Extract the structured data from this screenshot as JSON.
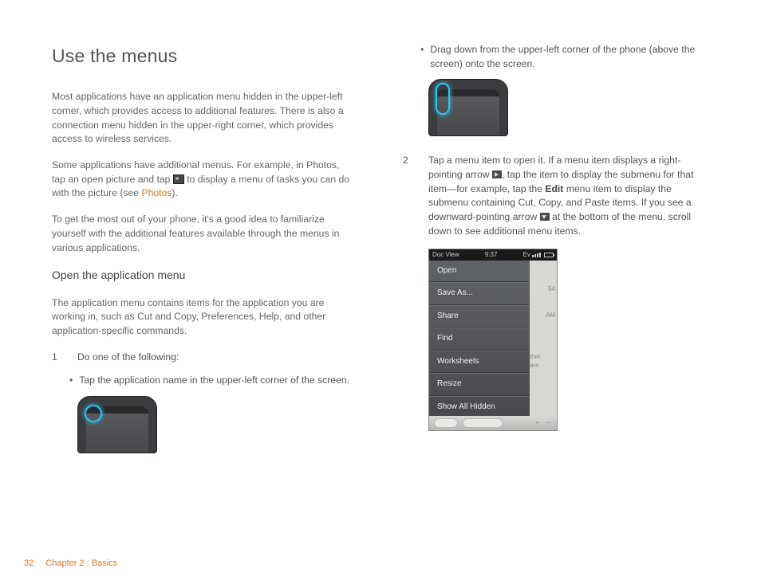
{
  "title": "Use the menus",
  "intro1": "Most applications have an application menu hidden in the upper-left corner, which provides access to additional features. There is also a connection menu hidden in the upper-right corner, which provides access to wireless services.",
  "intro2a": "Some applications have additional menus. For example, in Photos, tap an open picture and tap ",
  "intro2b": " to display a menu of tasks you can do with the picture (see ",
  "photos_link": "Photos",
  "intro2c": ").",
  "intro3": "To get the most out of your phone, it's a good idea to familiarize yourself with the additional features available through the menus in various applications.",
  "h2": "Open the application menu",
  "app_menu_p": "The application menu contains items for the application you are working in, such as Cut and Copy, Preferences, Help, and other application-specific commands.",
  "step1_num": "1",
  "step1_text": "Do one of the following:",
  "bullet1": "Tap the application name in the upper-left corner of the screen.",
  "bullet2": "Drag down from the upper-left corner of the phone (above the screen) onto the screen.",
  "step2_num": "2",
  "step2_a": "Tap a menu item to open it. If a menu item displays a right-pointing arrow ",
  "step2_b": ", tap the item to display the submenu for that item—for example, tap the ",
  "edit_bold": "Edit",
  "step2_c": " menu item to display the submenu containing Cut, Copy, and Paste items. If you see a downward-pointing arrow ",
  "step2_d": " at the bottom of the menu, scroll down to see additional menu items.",
  "menu": {
    "status_left": "Doc View",
    "status_time": "9:37",
    "status_ev": "Ev",
    "items": [
      "Open",
      "Save As...",
      "Share",
      "Find",
      "Worksheets",
      "Resize",
      "Show All Hidden"
    ],
    "behind1": "ther",
    "behind2": "are",
    "behind_num1": "54",
    "behind_num2": "AM"
  },
  "footer": {
    "page": "32",
    "chapter": "Chapter 2 : Basics"
  }
}
